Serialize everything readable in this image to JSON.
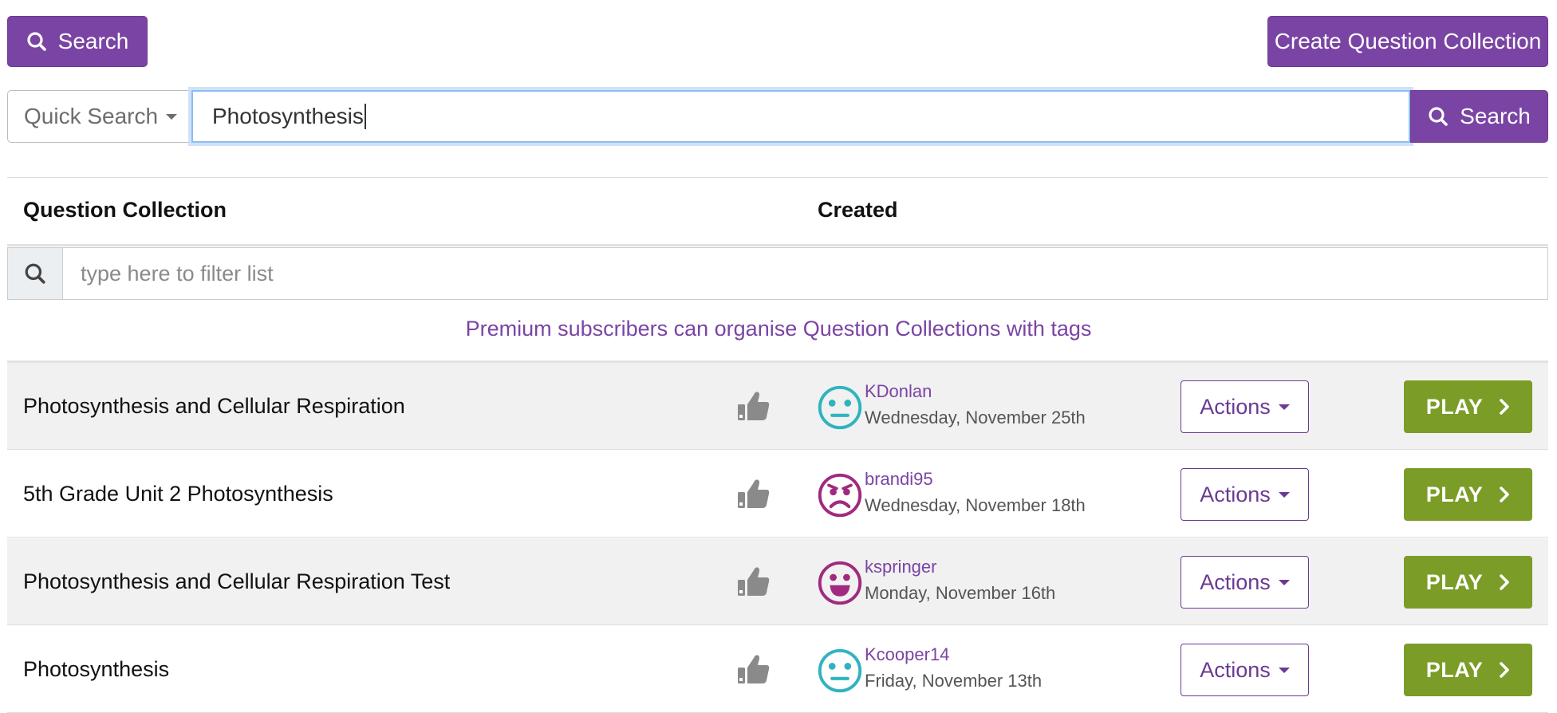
{
  "toolbar": {
    "search_label": "Search",
    "create_label": "Create Question Collection"
  },
  "search": {
    "mode_label": "Quick Search",
    "query": "Photosynthesis",
    "button_label": "Search"
  },
  "table": {
    "col_collection": "Question Collection",
    "col_created": "Created",
    "filter_placeholder": "type here to filter list",
    "premium_note": "Premium subscribers can organise Question Collections with tags",
    "actions_label": "Actions",
    "play_label": "PLAY",
    "rows": [
      {
        "title": "Photosynthesis and Cellular Respiration",
        "user": "KDonlan",
        "date": "Wednesday, November 25th",
        "avatar": "neutral-face-icon",
        "avatar_color": "#2fb3c0",
        "user_color": "#7a44a4"
      },
      {
        "title": "5th Grade Unit 2 Photosynthesis",
        "user": "brandi95",
        "date": "Wednesday, November 18th",
        "avatar": "angry-face-icon",
        "avatar_color": "#a02a7f",
        "user_color": "#7a44a4"
      },
      {
        "title": "Photosynthesis and Cellular Respiration Test",
        "user": "kspringer",
        "date": "Monday, November 16th",
        "avatar": "grinning-face-icon",
        "avatar_color": "#a02a7f",
        "user_color": "#7a44a4"
      },
      {
        "title": "Photosynthesis",
        "user": "Kcooper14",
        "date": "Friday, November 13th",
        "avatar": "neutral-face-icon",
        "avatar_color": "#2fb3c0",
        "user_color": "#7a44a4"
      }
    ]
  },
  "colors": {
    "brand_purple": "#7a44a4",
    "play_green": "#7b9c27",
    "focus_blue": "#8dbdf0"
  }
}
